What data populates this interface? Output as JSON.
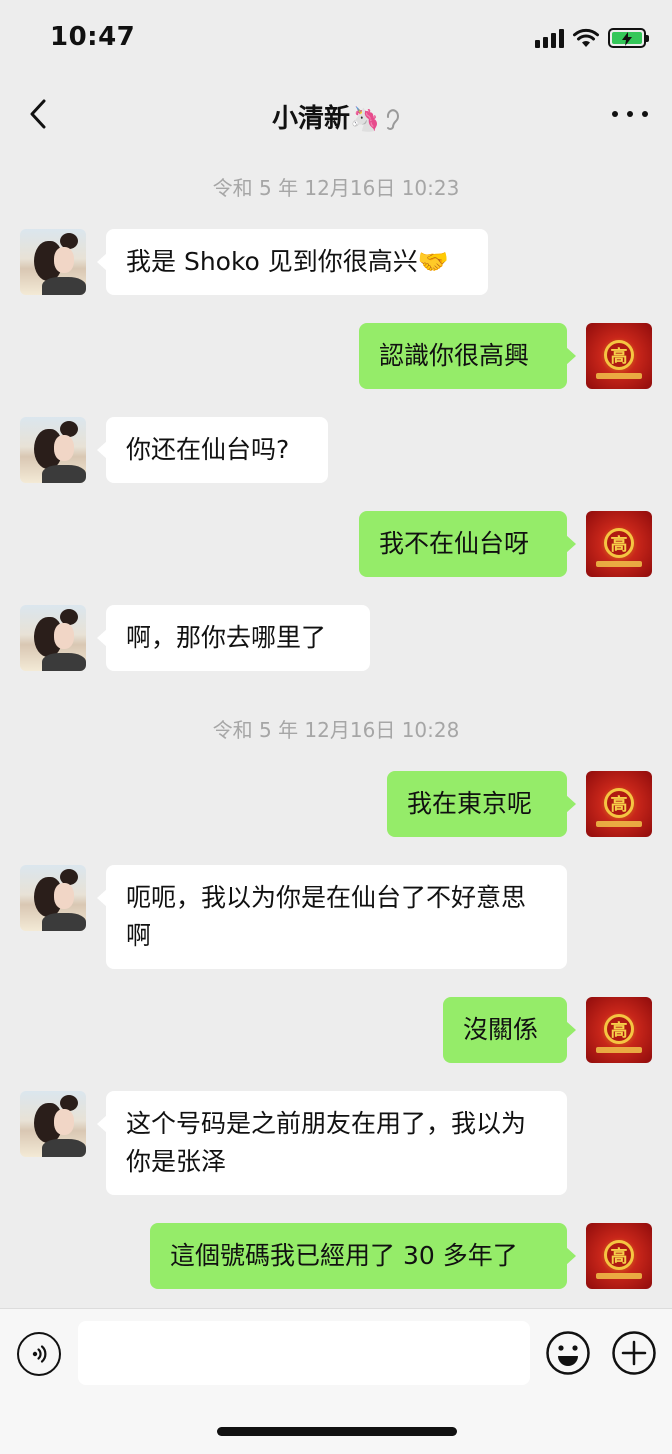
{
  "status_bar": {
    "time": "10:47",
    "battery_level": 1.0,
    "battery_charging": true,
    "battery_color": "#34c759",
    "icons": [
      "signal-icon",
      "wifi-icon",
      "battery-charging-icon"
    ]
  },
  "nav": {
    "title": "小清新",
    "title_emoji": "🦄",
    "back_icon": "chevron-left-icon",
    "ear_icon": "ear-icon",
    "more_icon": "more-dots-icon"
  },
  "chat": {
    "timestamps": [
      "令和 5 年 12月16日 10:23",
      "令和 5 年 12月16日 10:28"
    ],
    "messages": [
      {
        "sender": "other",
        "text": "我是 Shoko 见到你很高兴",
        "emoji": "🤝"
      },
      {
        "sender": "me",
        "text": "認識你很高興"
      },
      {
        "sender": "other",
        "text": "你还在仙台吗?"
      },
      {
        "sender": "me",
        "text": "我不在仙台呀"
      },
      {
        "sender": "other",
        "text": "啊，那你去哪里了"
      },
      {
        "sender": "me",
        "text": "我在東京呢"
      },
      {
        "sender": "other",
        "text": "呃呃，我以为你是在仙台了不好意思啊"
      },
      {
        "sender": "me",
        "text": "沒關係"
      },
      {
        "sender": "other",
        "text": "这个号码是之前朋友在用了，我以为你是张泽"
      },
      {
        "sender": "me",
        "text": "這個號碼我已經用了 30 多年了"
      }
    ],
    "colors": {
      "incoming_bubble": "#ffffff",
      "outgoing_bubble": "#95ec69",
      "background": "#ededed",
      "timestamp": "#a6a6a6"
    },
    "avatar_other_glyph": "高"
  },
  "input_bar": {
    "value": "",
    "icons": [
      "voice-icon",
      "emoji-icon",
      "plus-icon"
    ]
  }
}
